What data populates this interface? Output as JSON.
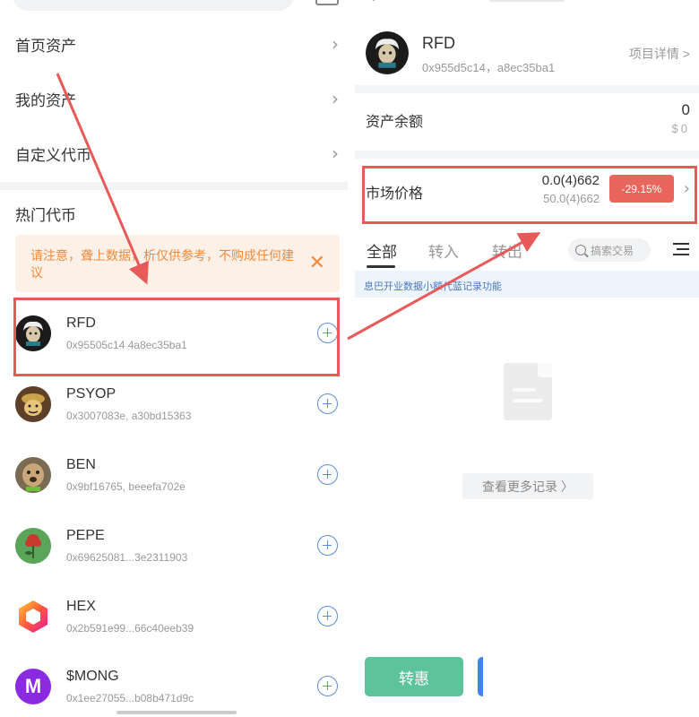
{
  "left": {
    "menu": [
      {
        "label": "首页资产"
      },
      {
        "label": "我的资产"
      },
      {
        "label": "自定义代币"
      }
    ],
    "section_title": "热门代币",
    "notice": {
      "text": "请注意，聋上数据，析仅供参考，不购成任何建议"
    },
    "tokens": [
      {
        "name": "RFD",
        "address": "0x95505c14   4a8ec35ba1",
        "icon": "rfd-avatar-icon"
      },
      {
        "name": "PSYOP",
        "address": "0x3007083e, a30bd15363",
        "icon": "psyop-avatar-icon"
      },
      {
        "name": "BEN",
        "address": "0x9bf16765, beeefa702e",
        "icon": "ben-avatar-icon"
      },
      {
        "name": "PEPE",
        "address": "0x69625081...3e2311903",
        "icon": "pepe-avatar-icon"
      },
      {
        "name": "HEX",
        "address": "0x2b591e99...66c40eeb39",
        "icon": "hex-avatar-icon"
      },
      {
        "name": "$MONG",
        "address": "0x1ee27055...b08b471d9c",
        "icon": "mong-avatar-icon",
        "glyph": "M"
      }
    ]
  },
  "right": {
    "token": {
      "name": "RFD",
      "address": "0x955d5c14，a8ec35ba1",
      "detail_link": "项目详情 >"
    },
    "balance": {
      "label": "资产余额",
      "value": "0",
      "sub": "$0"
    },
    "market": {
      "label": "市场价格",
      "price": "0.0(4)662",
      "price_secondary": "50.0(4)662",
      "change": "-29.15%"
    },
    "tabs": [
      {
        "label": "全部"
      },
      {
        "label": "转入"
      },
      {
        "label": "转出"
      }
    ],
    "search_placeholder": "搞索交易",
    "info_banner": "息巴开业数据小额代蓝记录功能",
    "more_records": "查看更多记录 〉",
    "transfer_button": "转惠"
  },
  "colors": {
    "accent_green": "#5cc39a",
    "accent_blue": "#3e86e6",
    "change_red": "#e8665b",
    "annotation_red": "#e85a5a",
    "notice_orange": "#f08a3c"
  }
}
